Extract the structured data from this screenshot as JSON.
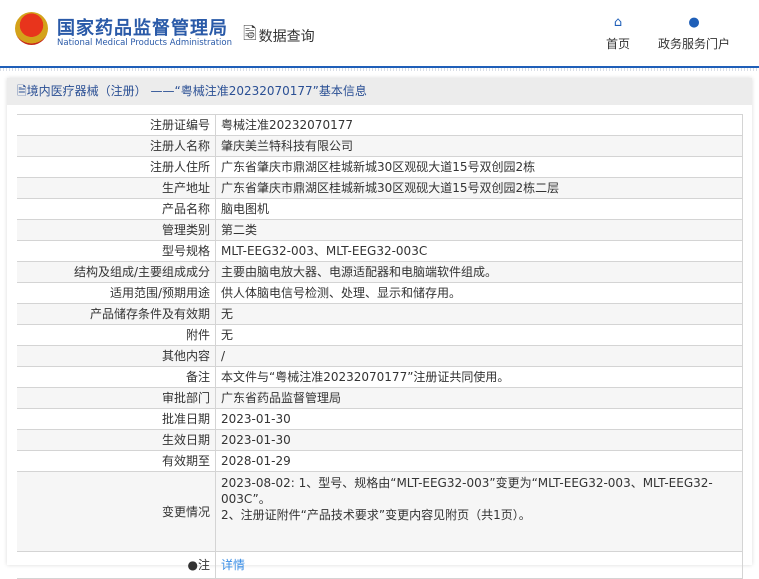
{
  "header": {
    "title_cn": "国家药品监督管理局",
    "title_en": "National Medical Products Administration",
    "data_query": "数据查询",
    "nav": [
      {
        "label": "首页",
        "icon": "home-icon"
      },
      {
        "label": "政务服务门户",
        "icon": "user-icon"
      }
    ]
  },
  "panel": {
    "title": "境内医疗器械（注册） ——“粤械注准20232070177”基本信息"
  },
  "rows": [
    {
      "label": "注册证编号",
      "value": "粤械注准20232070177"
    },
    {
      "label": "注册人名称",
      "value": "肇庆美兰特科技有限公司"
    },
    {
      "label": "注册人住所",
      "value": "广东省肇庆市鼎湖区桂城新城30区观砚大道15号双创园2栋"
    },
    {
      "label": "生产地址",
      "value": "广东省肇庆市鼎湖区桂城新城30区观砚大道15号双创园2栋二层"
    },
    {
      "label": "产品名称",
      "value": "脑电图机"
    },
    {
      "label": "管理类别",
      "value": "第二类"
    },
    {
      "label": "型号规格",
      "value": "MLT-EEG32-003、MLT-EEG32-003C"
    },
    {
      "label": "结构及组成/主要组成成分",
      "value": "主要由脑电放大器、电源适配器和电脑端软件组成。"
    },
    {
      "label": "适用范围/预期用途",
      "value": "供人体脑电信号检测、处理、显示和储存用。"
    },
    {
      "label": "产品储存条件及有效期",
      "value": "无"
    },
    {
      "label": "附件",
      "value": "无"
    },
    {
      "label": "其他内容",
      "value": "/"
    },
    {
      "label": "备注",
      "value": "本文件与“粤械注准20232070177”注册证共同使用。"
    },
    {
      "label": "审批部门",
      "value": "广东省药品监督管理局"
    },
    {
      "label": "批准日期",
      "value": "2023-01-30"
    },
    {
      "label": "生效日期",
      "value": "2023-01-30"
    },
    {
      "label": "有效期至",
      "value": "2028-01-29"
    }
  ],
  "change": {
    "label": "变更情况",
    "line1": "2023-08-02: 1、型号、规格由“MLT-EEG32-003”变更为“MLT-EEG32-003、MLT-EEG32-003C”。",
    "line2": "2、注册证附件“产品技术要求”变更内容见附页（共1页）。"
  },
  "note": {
    "label": "注",
    "link": "详情"
  }
}
